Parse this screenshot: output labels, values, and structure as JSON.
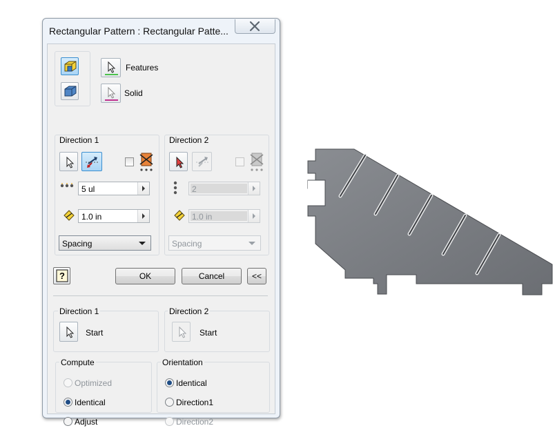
{
  "dialog": {
    "title": "Rectangular Pattern : Rectangular Patte...",
    "close_glyph": "✕"
  },
  "selection": {
    "features_label": "Features",
    "solid_label": "Solid"
  },
  "direction1": {
    "header": "Direction 1",
    "count_value": "5 ul",
    "spacing_value": "1.0 in",
    "mode_value": "Spacing"
  },
  "direction2": {
    "header": "Direction 2",
    "count_value": "2",
    "spacing_value": "1.0 in",
    "mode_value": "Spacing"
  },
  "buttons": {
    "help_glyph": "?",
    "ok": "OK",
    "cancel": "Cancel",
    "collapse": "<<"
  },
  "start": {
    "direction1_header": "Direction 1",
    "direction1_start": "Start",
    "direction2_header": "Direction 2",
    "direction2_start": "Start"
  },
  "compute": {
    "header": "Compute",
    "options": [
      "Optimized",
      "Identical",
      "Adjust"
    ],
    "selected": "Identical"
  },
  "orientation": {
    "header": "Orientation",
    "options": [
      "Identical",
      "Direction1",
      "Direction2"
    ],
    "selected": "Identical"
  },
  "colors": {
    "features_underline": "#4cc24c",
    "solid_underline": "#c0308e",
    "part_fill": "#7a7d82"
  }
}
